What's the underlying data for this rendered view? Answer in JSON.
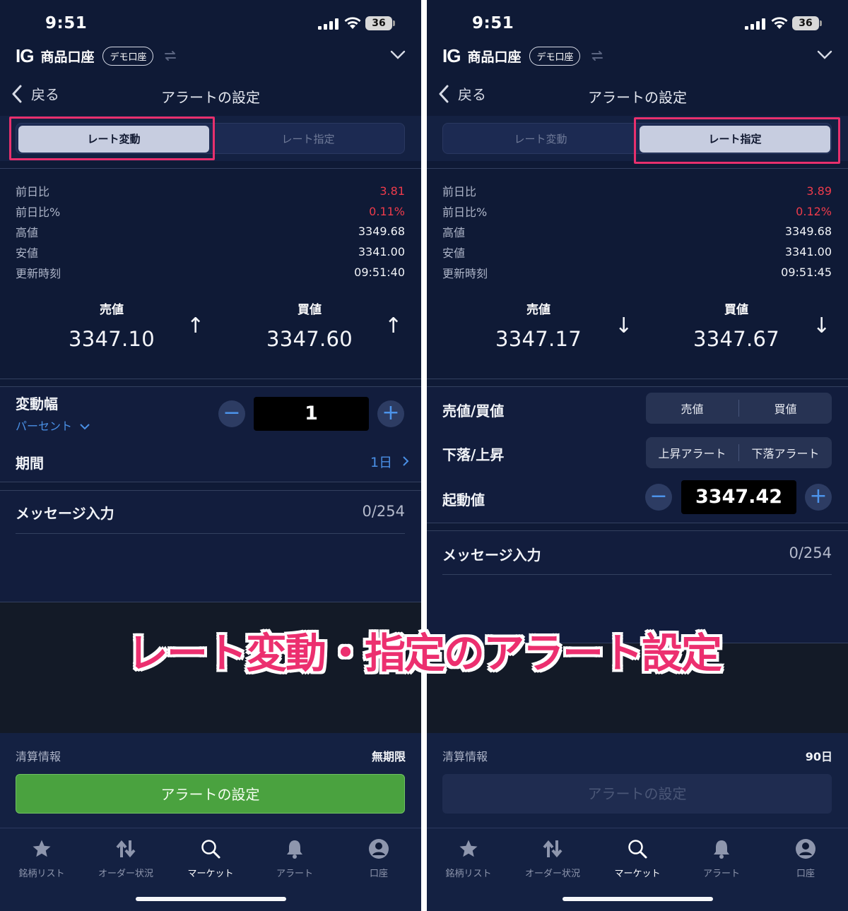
{
  "overlay_title": "レート変動・指定のアラート設定",
  "left": {
    "status": {
      "time": "9:51",
      "battery": "36"
    },
    "account": {
      "logo": "IG",
      "name": "商品口座",
      "badge": "デモ口座"
    },
    "nav": {
      "back": "戻る",
      "title": "アラートの設定"
    },
    "tabs": [
      {
        "label": "レート変動",
        "active": true
      },
      {
        "label": "レート指定",
        "active": false
      }
    ],
    "stats": [
      {
        "label": "前日比",
        "value": "3.81"
      },
      {
        "label": "前日比%",
        "value": "0.11%"
      },
      {
        "label": "高値",
        "value": "3349.68"
      },
      {
        "label": "安値",
        "value": "3341.00"
      },
      {
        "label": "更新時刻",
        "value": "09:51:40"
      }
    ],
    "sell": {
      "label": "売値",
      "value": "3347.10",
      "arrow": "↑"
    },
    "buy": {
      "label": "買値",
      "value": "3347.60",
      "arrow": "↑"
    },
    "change_width": {
      "label": "変動幅",
      "unit": "パーセント",
      "value": "1"
    },
    "period": {
      "label": "期間",
      "value": "1日"
    },
    "message": {
      "label": "メッセージ入力",
      "counter": "0/254"
    },
    "footer": {
      "label": "清算情報",
      "value": "無期限",
      "button": "アラートの設定"
    }
  },
  "right": {
    "status": {
      "time": "9:51",
      "battery": "36"
    },
    "account": {
      "logo": "IG",
      "name": "商品口座",
      "badge": "デモ口座"
    },
    "nav": {
      "back": "戻る",
      "title": "アラートの設定"
    },
    "tabs": [
      {
        "label": "レート変動",
        "active": false
      },
      {
        "label": "レート指定",
        "active": true
      }
    ],
    "stats": [
      {
        "label": "前日比",
        "value": "3.89"
      },
      {
        "label": "前日比%",
        "value": "0.12%"
      },
      {
        "label": "高値",
        "value": "3349.68"
      },
      {
        "label": "安値",
        "value": "3341.00"
      },
      {
        "label": "更新時刻",
        "value": "09:51:45"
      }
    ],
    "sell": {
      "label": "売値",
      "value": "3347.17",
      "arrow": "↓"
    },
    "buy": {
      "label": "買値",
      "value": "3347.67",
      "arrow": "↓"
    },
    "price_side": {
      "label": "売値/買値",
      "options": [
        "売値",
        "買値"
      ]
    },
    "direction": {
      "label": "下落/上昇",
      "options": [
        "上昇アラート",
        "下落アラート"
      ]
    },
    "trigger": {
      "label": "起動値",
      "value": "3347.42"
    },
    "message": {
      "label": "メッセージ入力",
      "counter": "0/254"
    },
    "footer": {
      "label": "清算情報",
      "value": "90日",
      "button": "アラートの設定"
    }
  },
  "tabbar": [
    {
      "label": "銘柄リスト",
      "icon": "star-icon"
    },
    {
      "label": "オーダー状況",
      "icon": "up-down-arrows-icon"
    },
    {
      "label": "マーケット",
      "icon": "search-icon",
      "active": true
    },
    {
      "label": "アラート",
      "icon": "bell-icon"
    },
    {
      "label": "口座",
      "icon": "account-icon"
    }
  ],
  "colors": {
    "background": "#0f1a36",
    "negative": "#ee3b4b",
    "accent": "#4a90e6",
    "cta": "#4aa23f",
    "highlight": "#e8306d"
  }
}
